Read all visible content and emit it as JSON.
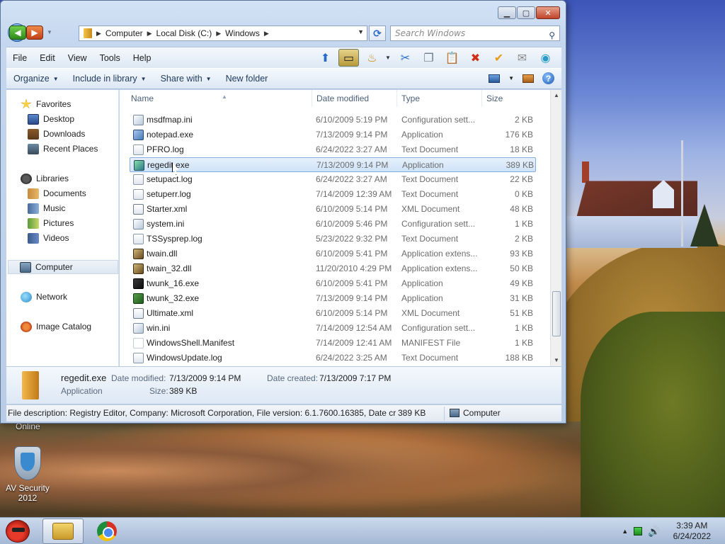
{
  "window": {
    "address_crumbs": [
      "Computer",
      "Local Disk (C:)",
      "Windows"
    ],
    "search_placeholder": "Search Windows",
    "menu": [
      "File",
      "Edit",
      "View",
      "Tools",
      "Help"
    ],
    "commands": {
      "organize": "Organize",
      "include_in_library": "Include in library",
      "share_with": "Share with",
      "new_folder": "New folder"
    },
    "columns": {
      "name": "Name",
      "date_modified": "Date modified",
      "type": "Type",
      "size": "Size"
    }
  },
  "navigation": {
    "favorites": {
      "label": "Favorites",
      "items": [
        "Desktop",
        "Downloads",
        "Recent Places"
      ]
    },
    "libraries": {
      "label": "Libraries",
      "items": [
        "Documents",
        "Music",
        "Pictures",
        "Videos"
      ]
    },
    "computer": "Computer",
    "network": "Network",
    "image_catalog": "Image Catalog"
  },
  "files": [
    {
      "name": "msdfmap.ini",
      "date": "6/10/2009 5:19 PM",
      "type": "Configuration sett...",
      "size": "2 KB",
      "icon": "ini"
    },
    {
      "name": "notepad.exe",
      "date": "7/13/2009 9:14 PM",
      "type": "Application",
      "size": "176 KB",
      "icon": "exe"
    },
    {
      "name": "PFRO.log",
      "date": "6/24/2022 3:27 AM",
      "type": "Text Document",
      "size": "18 KB",
      "icon": "log"
    },
    {
      "name": "regedit.exe",
      "date": "7/13/2009 9:14 PM",
      "type": "Application",
      "size": "389 KB",
      "icon": "reg",
      "selected": true
    },
    {
      "name": "setupact.log",
      "date": "6/24/2022 3:27 AM",
      "type": "Text Document",
      "size": "22 KB",
      "icon": "log"
    },
    {
      "name": "setuperr.log",
      "date": "7/14/2009 12:39 AM",
      "type": "Text Document",
      "size": "0 KB",
      "icon": "log"
    },
    {
      "name": "Starter.xml",
      "date": "6/10/2009 5:14 PM",
      "type": "XML Document",
      "size": "48 KB",
      "icon": "xml"
    },
    {
      "name": "system.ini",
      "date": "6/10/2009 5:46 PM",
      "type": "Configuration sett...",
      "size": "1 KB",
      "icon": "ini"
    },
    {
      "name": "TSSysprep.log",
      "date": "5/23/2022 9:32 PM",
      "type": "Text Document",
      "size": "2 KB",
      "icon": "log"
    },
    {
      "name": "twain.dll",
      "date": "6/10/2009 5:41 PM",
      "type": "Application extens...",
      "size": "93 KB",
      "icon": "dll"
    },
    {
      "name": "twain_32.dll",
      "date": "11/20/2010 4:29 PM",
      "type": "Application extens...",
      "size": "50 KB",
      "icon": "dll"
    },
    {
      "name": "twunk_16.exe",
      "date": "6/10/2009 5:41 PM",
      "type": "Application",
      "size": "49 KB",
      "icon": "twunk"
    },
    {
      "name": "twunk_32.exe",
      "date": "7/13/2009 9:14 PM",
      "type": "Application",
      "size": "31 KB",
      "icon": "twunk32"
    },
    {
      "name": "Ultimate.xml",
      "date": "6/10/2009 5:14 PM",
      "type": "XML Document",
      "size": "51 KB",
      "icon": "xml"
    },
    {
      "name": "win.ini",
      "date": "7/14/2009 12:54 AM",
      "type": "Configuration sett...",
      "size": "1 KB",
      "icon": "ini"
    },
    {
      "name": "WindowsShell.Manifest",
      "date": "7/14/2009 12:41 AM",
      "type": "MANIFEST File",
      "size": "1 KB",
      "icon": "manifest"
    },
    {
      "name": "WindowsUpdate.log",
      "date": "6/24/2022 3:25 AM",
      "type": "Text Document",
      "size": "188 KB",
      "icon": "log"
    }
  ],
  "details": {
    "name": "regedit.exe",
    "kind": "Application",
    "date_modified_label": "Date modified:",
    "date_modified": "7/13/2009 9:14 PM",
    "date_created_label": "Date created:",
    "date_created": "7/13/2009 7:17 PM",
    "size_label": "Size:",
    "size": "389 KB"
  },
  "status": {
    "description": "File description: Registry Editor, Company: Microsoft Corporation, File version: 6.1.7600.16385, Date cre",
    "size": "389 KB",
    "location": "Computer"
  },
  "desktop": {
    "online_label": "Online",
    "icon_label_line1": "AV Security",
    "icon_label_line2": "2012"
  },
  "taskbar": {
    "time": "3:39 AM",
    "date": "6/24/2022"
  }
}
